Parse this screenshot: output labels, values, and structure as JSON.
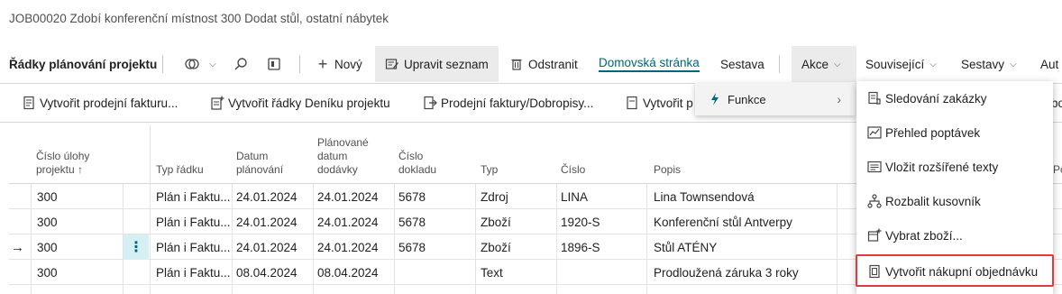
{
  "title": "JOB00020 Zdobí konferenční místnost 300 Dodat stůl, ostatní nábytek",
  "toolbar": {
    "heading": "Řádky plánování projektu",
    "new": "Nový",
    "edit_list": "Upravit seznam",
    "delete": "Odstranit",
    "home": "Domovská stránka",
    "report": "Sestava",
    "actions": "Akce",
    "related": "Související",
    "reports": "Sestavy",
    "automate": "Aut"
  },
  "actionbar": {
    "create_sales_invoice": "Vytvořit prodejní fakturu...",
    "create_journal_lines": "Vytvořit řádky Deníku projektu",
    "sales_invoices": "Prodejní faktury/Dobropisy...",
    "create_p": "Vytvořit p",
    "right_cut": "bo"
  },
  "menu_functions": {
    "label": "Funkce"
  },
  "menu_sub": {
    "items": [
      "Sledování zakázky",
      "Přehled poptávek",
      "Vložit rozšířené texty",
      "Rozbalit kusovník",
      "Vybrat zboží...",
      "Vytvořit nákupní objednávku"
    ]
  },
  "columns": {
    "task_no": "Číslo úlohy projektu ↑",
    "line_type": "Typ řádku",
    "planning_date": "Datum plánování",
    "delivery_date": "Plánované datum dodávky",
    "doc_no": "Číslo dokladu",
    "type": "Typ",
    "no": "Číslo",
    "description": "Popis",
    "right_cut": "Po"
  },
  "rows": [
    {
      "marker": "",
      "task": "300",
      "line_type": "Plán i Faktu...",
      "plan": "24.01.2024",
      "deliv": "24.01.2024",
      "doc": "5678",
      "type": "Zdroj",
      "no": "LINA",
      "desc": "Lina Townsendová"
    },
    {
      "marker": "",
      "task": "300",
      "line_type": "Plán i Faktu...",
      "plan": "24.01.2024",
      "deliv": "24.01.2024",
      "doc": "5678",
      "type": "Zboží",
      "no": "1920-S",
      "desc": "Konferenční stůl Antverpy"
    },
    {
      "marker": "→",
      "task": "300",
      "line_type": "Plán i Faktu...",
      "plan": "24.01.2024",
      "deliv": "24.01.2024",
      "doc": "5678",
      "type": "Zboží",
      "no": "1896-S",
      "desc": "Stůl ATÉNY"
    },
    {
      "marker": "",
      "task": "300",
      "line_type": "Plán i Faktu...",
      "plan": "08.04.2024",
      "deliv": "08.04.2024",
      "doc": "",
      "type": "Text",
      "no": "",
      "desc": "Prodloužená záruka 3 roky"
    }
  ],
  "row_menu_glyph": "⋮",
  "colors": {
    "accent": "#00667c",
    "highlight": "#e03c3c"
  }
}
